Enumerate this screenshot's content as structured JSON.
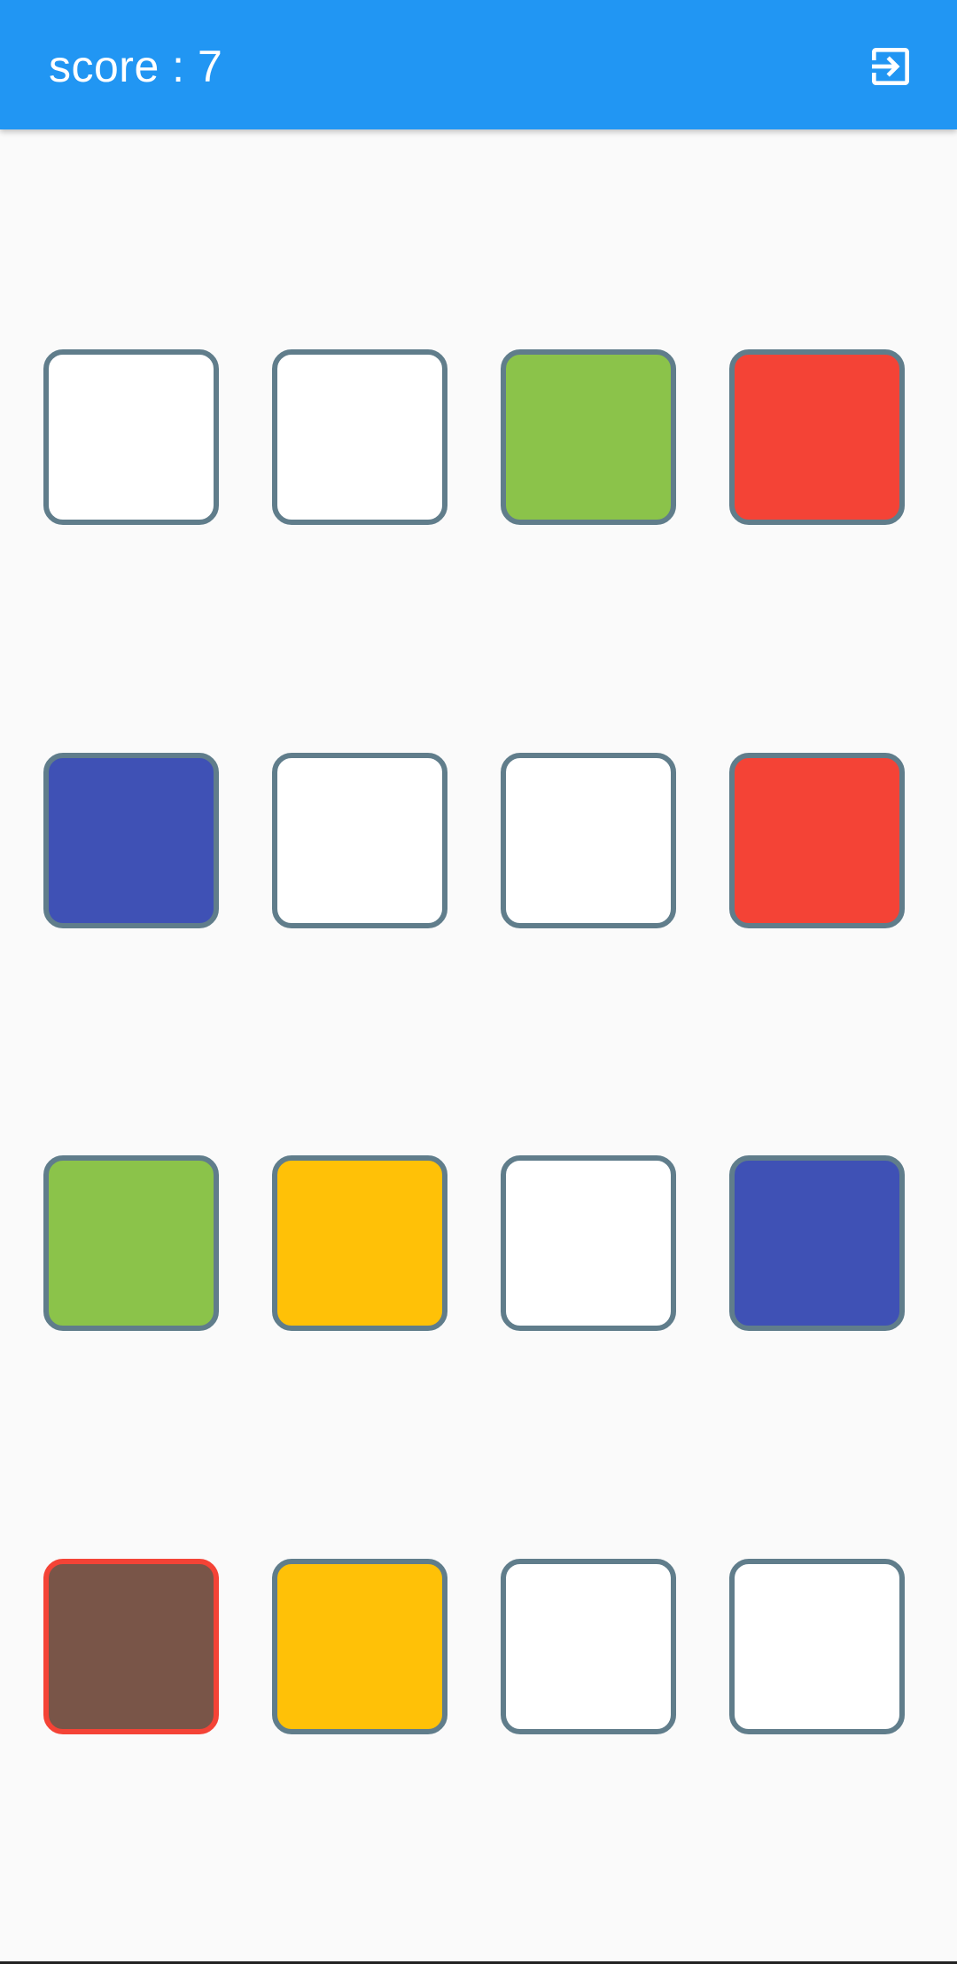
{
  "header": {
    "score_text": "score : 7",
    "exit_icon": "exit-to-app-icon"
  },
  "colors": {
    "appbar": "#2196f3",
    "background": "#fafafa",
    "tile_border": "#607d8b",
    "selected_border": "#f44336",
    "white": "#ffffff",
    "green": "#8bc34a",
    "red": "#f44336",
    "indigo": "#3f51b5",
    "amber": "#ffc107",
    "brown": "#795548"
  },
  "grid": {
    "rows": [
      [
        "white",
        "white",
        "green",
        "red"
      ],
      [
        "indigo",
        "white",
        "white",
        "red"
      ],
      [
        "green",
        "amber",
        "white",
        "indigo"
      ],
      [
        "brown",
        "amber",
        "white",
        "white"
      ]
    ],
    "selected": [
      3,
      0
    ]
  }
}
